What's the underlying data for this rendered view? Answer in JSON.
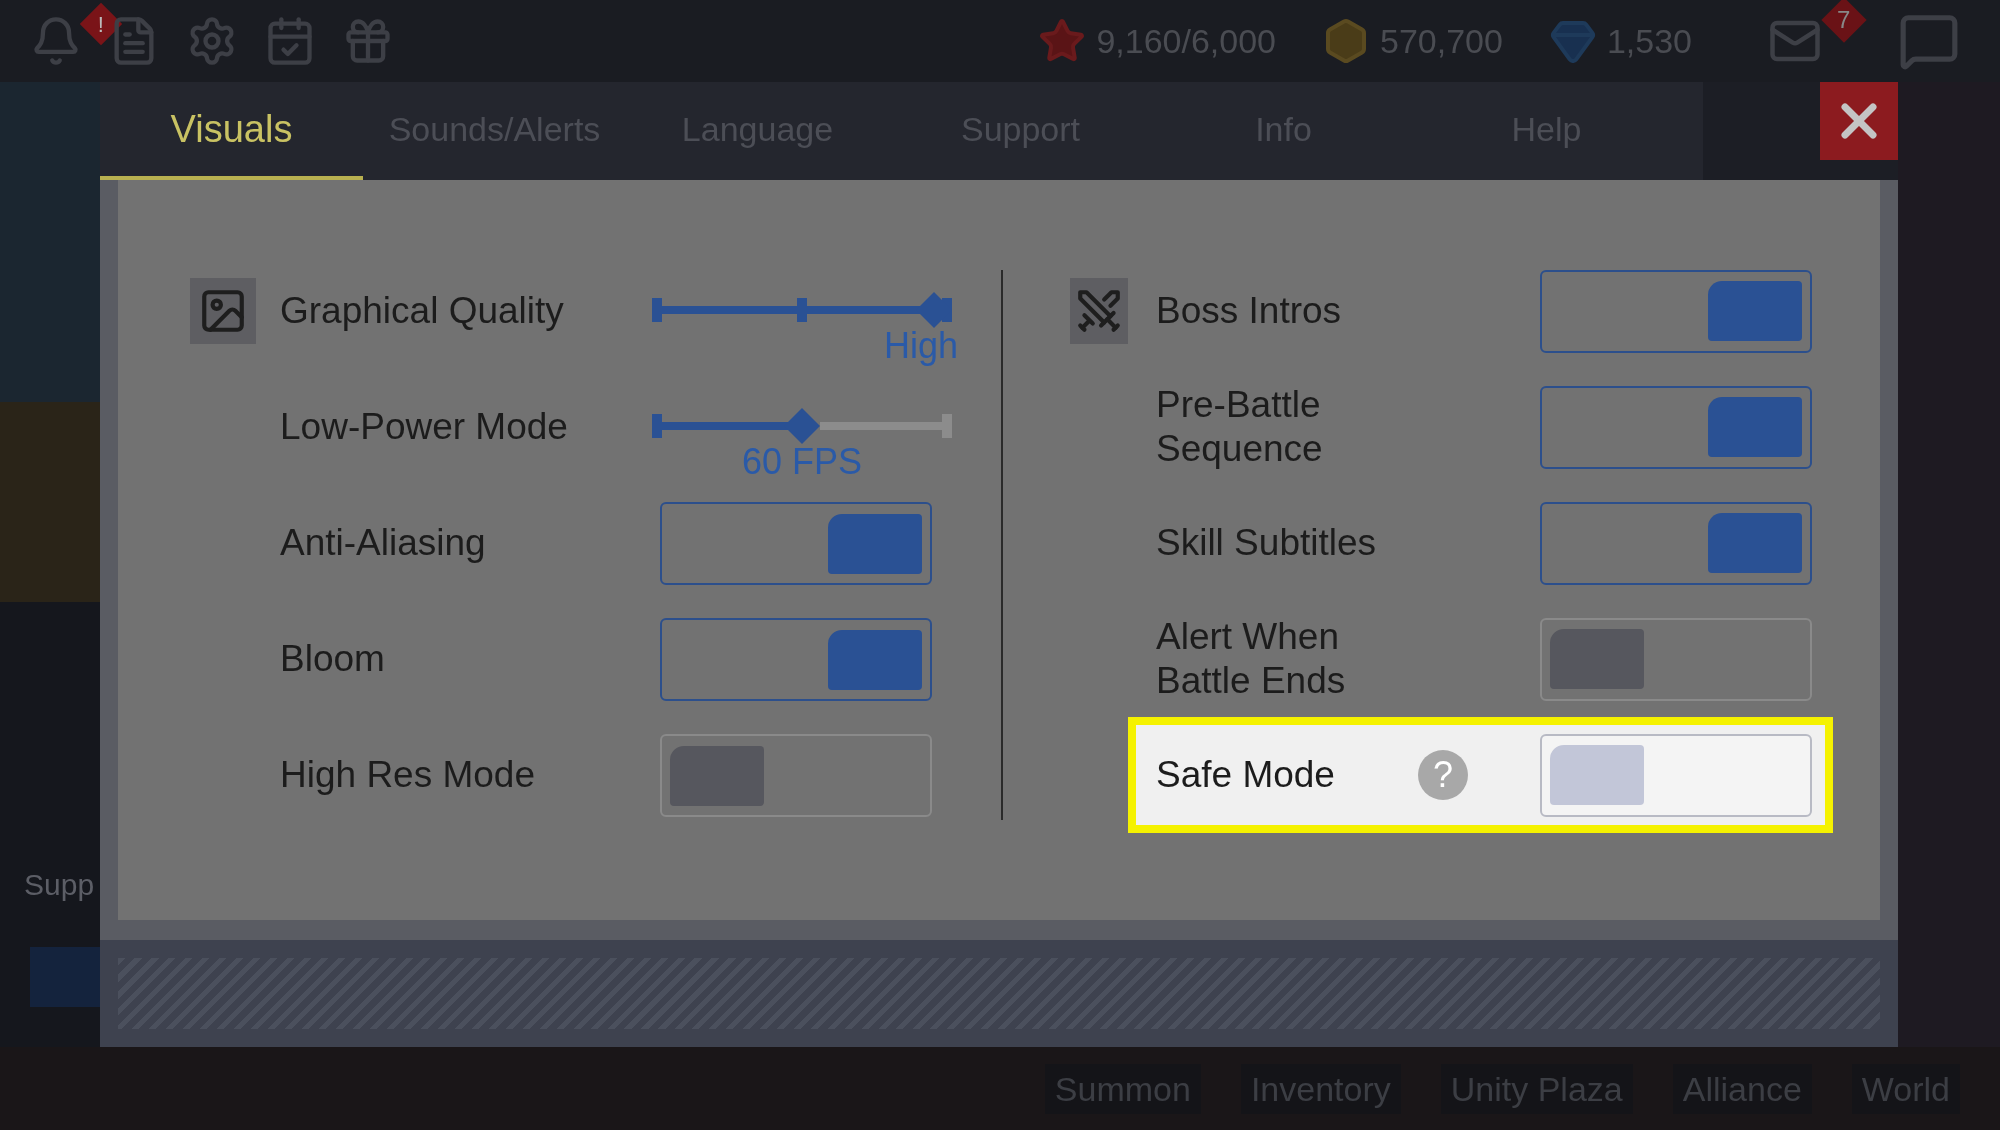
{
  "hud": {
    "alert_badge": "!",
    "resources": [
      {
        "value": "9,160/6,000"
      },
      {
        "value": "570,700"
      },
      {
        "value": "1,530"
      }
    ],
    "mail_badge": "7"
  },
  "tabs": [
    {
      "label": "Visuals",
      "selected": true
    },
    {
      "label": "Sounds/Alerts",
      "selected": false
    },
    {
      "label": "Language",
      "selected": false
    },
    {
      "label": "Support",
      "selected": false
    },
    {
      "label": "Info",
      "selected": false
    },
    {
      "label": "Help",
      "selected": false
    }
  ],
  "left_settings": [
    {
      "kind": "slider",
      "label": "Graphical Quality",
      "level": 1,
      "reading": "High"
    },
    {
      "kind": "slider",
      "label": "Low-Power Mode",
      "level": 0.5,
      "reading": "60 FPS"
    },
    {
      "kind": "toggle",
      "label": "Anti-Aliasing",
      "on": true
    },
    {
      "kind": "toggle",
      "label": "Bloom",
      "on": true
    },
    {
      "kind": "toggle",
      "label": "High Res Mode",
      "on": false
    }
  ],
  "right_settings": [
    {
      "kind": "toggle",
      "label": "Boss Intros",
      "on": true,
      "highlighted": false
    },
    {
      "kind": "toggle",
      "label": "Pre-Battle Sequence",
      "on": true,
      "highlighted": false
    },
    {
      "kind": "toggle",
      "label": "Skill Subtitles",
      "on": true,
      "highlighted": false
    },
    {
      "kind": "toggle",
      "label": "Alert When Battle Ends",
      "on": false,
      "highlighted": false
    },
    {
      "kind": "toggle",
      "label": "Safe Mode",
      "on": false,
      "highlighted": true,
      "help": "?"
    }
  ],
  "side_label": "Supp",
  "bottom_nav": [
    "Summon",
    "Inventory",
    "Unity Plaza",
    "Alliance",
    "World"
  ]
}
